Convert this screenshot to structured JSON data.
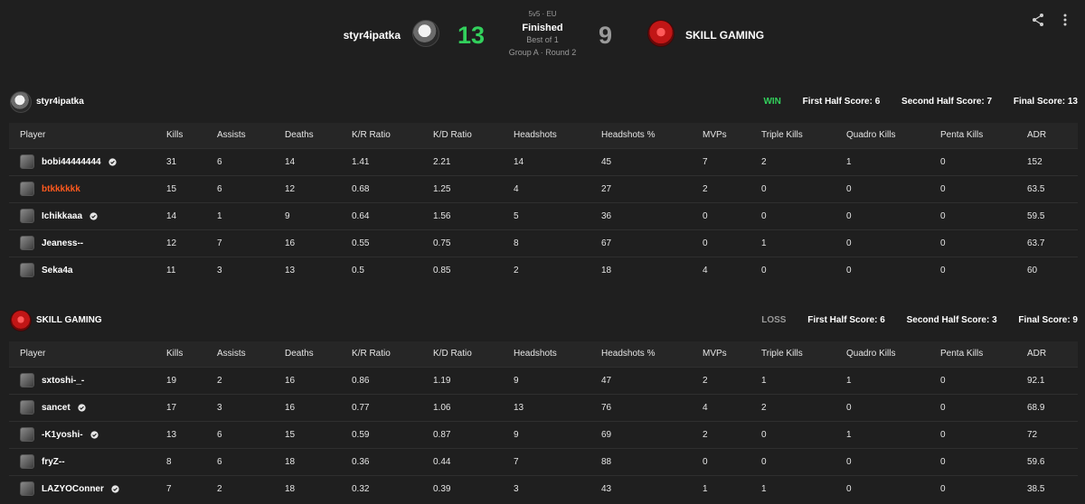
{
  "header": {
    "team_a": "styr4ipatka",
    "score_a": "13",
    "format": "5v5 · EU",
    "status": "Finished",
    "best_of": "Best of 1",
    "group_round": "Group A · Round 2",
    "score_b": "9",
    "team_b": "SKILL GAMING",
    "colors": {
      "win": "#32d05c",
      "loss": "#9a9a9a",
      "accent_orange": "#ff5a1f"
    }
  },
  "columns": [
    "Player",
    "Kills",
    "Assists",
    "Deaths",
    "K/R Ratio",
    "K/D Ratio",
    "Headshots",
    "Headshots %",
    "MVPs",
    "Triple Kills",
    "Quadro Kills",
    "Penta Kills",
    "ADR"
  ],
  "teams": [
    {
      "name": "styr4ipatka",
      "result": "WIN",
      "first_half": "First Half Score: 6",
      "second_half": "Second Half Score: 7",
      "final": "Final Score: 13",
      "players": [
        {
          "name": "bobi44444444",
          "verified": true,
          "highlight": false,
          "stats": [
            "31",
            "6",
            "14",
            "1.41",
            "2.21",
            "14",
            "45",
            "7",
            "2",
            "1",
            "0",
            "152"
          ]
        },
        {
          "name": "btkkkkkk",
          "verified": false,
          "highlight": true,
          "stats": [
            "15",
            "6",
            "12",
            "0.68",
            "1.25",
            "4",
            "27",
            "2",
            "0",
            "0",
            "0",
            "63.5"
          ]
        },
        {
          "name": "Ichikkaaa",
          "verified": true,
          "highlight": false,
          "stats": [
            "14",
            "1",
            "9",
            "0.64",
            "1.56",
            "5",
            "36",
            "0",
            "0",
            "0",
            "0",
            "59.5"
          ]
        },
        {
          "name": "Jeaness--",
          "verified": false,
          "highlight": false,
          "stats": [
            "12",
            "7",
            "16",
            "0.55",
            "0.75",
            "8",
            "67",
            "0",
            "1",
            "0",
            "0",
            "63.7"
          ]
        },
        {
          "name": "Seka4a",
          "verified": false,
          "highlight": false,
          "stats": [
            "11",
            "3",
            "13",
            "0.5",
            "0.85",
            "2",
            "18",
            "4",
            "0",
            "0",
            "0",
            "60"
          ]
        }
      ]
    },
    {
      "name": "SKILL GAMING",
      "result": "LOSS",
      "first_half": "First Half Score: 6",
      "second_half": "Second Half Score: 3",
      "final": "Final Score: 9",
      "players": [
        {
          "name": "sxtoshi-_-",
          "verified": false,
          "highlight": false,
          "stats": [
            "19",
            "2",
            "16",
            "0.86",
            "1.19",
            "9",
            "47",
            "2",
            "1",
            "1",
            "0",
            "92.1"
          ]
        },
        {
          "name": "sancet",
          "verified": true,
          "highlight": false,
          "stats": [
            "17",
            "3",
            "16",
            "0.77",
            "1.06",
            "13",
            "76",
            "4",
            "2",
            "0",
            "0",
            "68.9"
          ]
        },
        {
          "name": "-K1yoshi-",
          "verified": true,
          "highlight": false,
          "stats": [
            "13",
            "6",
            "15",
            "0.59",
            "0.87",
            "9",
            "69",
            "2",
            "0",
            "1",
            "0",
            "72"
          ]
        },
        {
          "name": "fryZ--",
          "verified": false,
          "highlight": false,
          "stats": [
            "8",
            "6",
            "18",
            "0.36",
            "0.44",
            "7",
            "88",
            "0",
            "0",
            "0",
            "0",
            "59.6"
          ]
        },
        {
          "name": "LAZYOConner",
          "verified": true,
          "highlight": false,
          "stats": [
            "7",
            "2",
            "18",
            "0.32",
            "0.39",
            "3",
            "43",
            "1",
            "1",
            "0",
            "0",
            "38.5"
          ]
        }
      ]
    }
  ]
}
